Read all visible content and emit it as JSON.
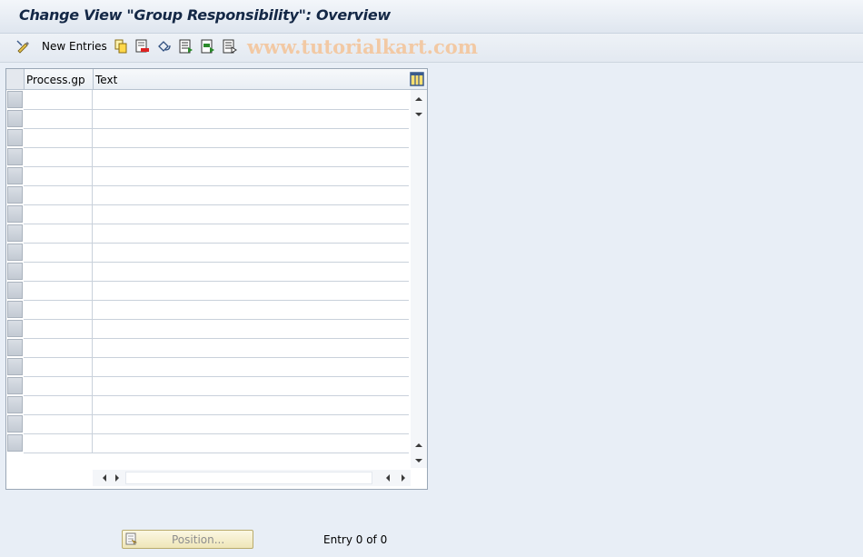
{
  "window": {
    "title": "Change View \"Group Responsibility\": Overview"
  },
  "toolbar": {
    "new_entries_label": "New Entries",
    "icons": [
      "display-change-icon",
      "copy-as-icon",
      "delete-icon",
      "undo-change-icon",
      "select-all-icon",
      "select-block-icon",
      "deselect-all-icon"
    ],
    "watermark": "www.tutorialkart.com"
  },
  "table": {
    "columns": [
      "Process.gp",
      "Text"
    ],
    "visible_row_count": 19
  },
  "footer": {
    "position_label": "Position...",
    "entry_info": "Entry 0 of 0"
  }
}
